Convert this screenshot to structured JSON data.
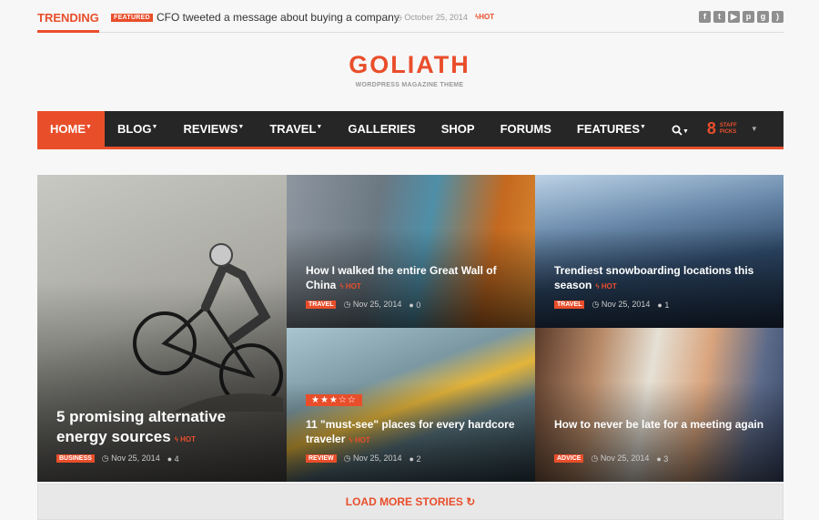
{
  "trending": {
    "label": "TRENDING",
    "badge": "FEATURED",
    "headline": "CFO tweeted a message about buying a company",
    "date": "October 25, 2014",
    "hot": "HOT"
  },
  "social": [
    {
      "icon": "facebook-icon",
      "glyph": "f"
    },
    {
      "icon": "twitter-icon",
      "glyph": "t"
    },
    {
      "icon": "youtube-icon",
      "glyph": "▶"
    },
    {
      "icon": "pinterest-icon",
      "glyph": "p"
    },
    {
      "icon": "googleplus-icon",
      "glyph": "g"
    },
    {
      "icon": "rss-icon",
      "glyph": ")"
    }
  ],
  "logo": {
    "name": "GOLIATH",
    "tagline": "WORDPRESS MAGAZINE THEME"
  },
  "nav": {
    "items": [
      {
        "label": "HOME",
        "caret": true,
        "active": true
      },
      {
        "label": "BLOG",
        "caret": true
      },
      {
        "label": "REVIEWS",
        "caret": true
      },
      {
        "label": "TRAVEL",
        "caret": true
      },
      {
        "label": "GALLERIES",
        "caret": false
      },
      {
        "label": "SHOP",
        "caret": false
      },
      {
        "label": "FORUMS",
        "caret": false
      },
      {
        "label": "FEATURES",
        "caret": true
      }
    ],
    "staff_count": "8",
    "staff_label": "STAFF PICKS"
  },
  "posts": [
    {
      "title": "5 promising alternative energy sources",
      "hot": "HOT",
      "category": "BUSINESS",
      "date": "Nov 25, 2014",
      "comments": "4"
    },
    {
      "title": "How I walked the entire Great Wall of China",
      "hot": "HOT",
      "category": "TRAVEL",
      "date": "Nov 25, 2014",
      "comments": "0"
    },
    {
      "title": "Trendiest snowboarding locations this season",
      "hot": "HOT",
      "category": "TRAVEL",
      "date": "Nov 25, 2014",
      "comments": "1"
    },
    {
      "title": "11 \"must-see\" places for every hardcore traveler",
      "hot": "HOT",
      "category": "REVIEW",
      "date": "Nov 25, 2014",
      "comments": "2",
      "rating": "3 of 5"
    },
    {
      "title": "How to never be late for a meeting again",
      "hot": "",
      "category": "ADVICE",
      "date": "Nov 25, 2014",
      "comments": "3"
    }
  ],
  "load_more": "LOAD MORE STORIES",
  "colors": {
    "accent": "#e94e2b",
    "nav_bg": "#262626"
  }
}
